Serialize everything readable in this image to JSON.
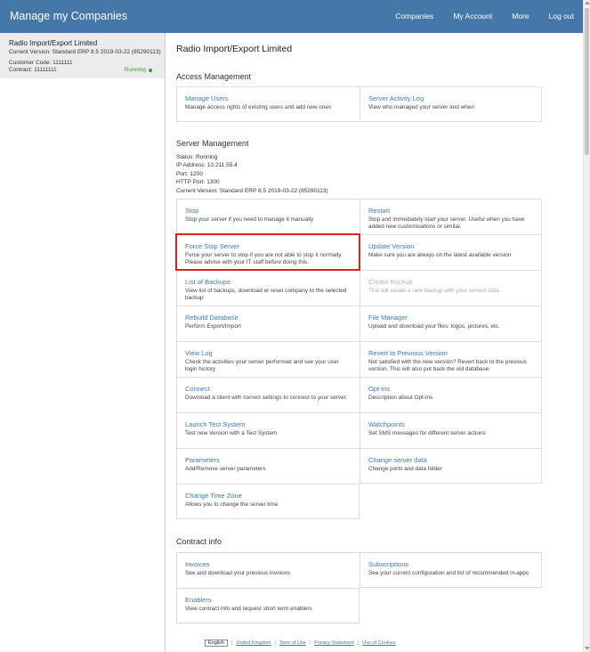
{
  "header": {
    "title": "Manage my Companies",
    "nav": [
      "Companies",
      "My Account",
      "More",
      "Log out"
    ]
  },
  "sidebar": {
    "company_name": "Radio Import/Export Limited",
    "version": "Current Version: Standard ERP 8.5 2019-03-22 (85290113)",
    "customer_code": "Customer Code: 1111111",
    "contract": "Contract: 11111111",
    "status": "Running"
  },
  "main": {
    "title": "Radio Import/Export Limited",
    "access_management": {
      "title": "Access Management",
      "items": [
        {
          "title": "Manage Users",
          "desc": "Manage access rights of existing users and add new ones"
        },
        {
          "title": "Server Activity Log",
          "desc": "View who managed your server and when"
        }
      ]
    },
    "server_management": {
      "title": "Server Management",
      "info": [
        "Status: Running",
        "IP Address: 10.211.55.4",
        "Port: 1200",
        "HTTP Port: 1300",
        "Current Version: Standard ERP 8.5 2019-03-22 (85290113)"
      ],
      "items": [
        {
          "title": "Stop",
          "desc": "Stop your server if you need to manage it manually"
        },
        {
          "title": "Restart",
          "desc": "Stop and immediately start your server. Useful when you have added new customisations or similar."
        },
        {
          "title": "Force Stop Server",
          "desc": "Force your server to stop if you are not able to stop it normally. Please advise with your IT staff before doing this."
        },
        {
          "title": "Update Version",
          "desc": "Make sure you are always on the latest available version"
        },
        {
          "title": "List of Backups",
          "desc": "View list of backups, download or reset company to the selected backup"
        },
        {
          "title": "Create Backup",
          "desc": "This will create a new backup with your current data."
        },
        {
          "title": "Rebuild Database",
          "desc": "Perform Export/Import"
        },
        {
          "title": "File Manager",
          "desc": "Upload and download your files: logos, pictures, etc."
        },
        {
          "title": "View Log",
          "desc": "Check the activities your server performed and see your user login history"
        },
        {
          "title": "Revert to Previous Version",
          "desc": "Not satisfied with the new version? Revert back to the previous version. This will also put back the old database."
        },
        {
          "title": "Connect",
          "desc": "Download a client with correct settings to connect to your server."
        },
        {
          "title": "Opt-ins",
          "desc": "Description about Opt-ins"
        },
        {
          "title": "Launch Test System",
          "desc": "Test new Version with a Test System"
        },
        {
          "title": "Watchpoints",
          "desc": "Set SMS messages for different server actions"
        },
        {
          "title": "Parameters",
          "desc": "Add/Remove server parameters"
        },
        {
          "title": "Change server data",
          "desc": "Change ports and data folder"
        },
        {
          "title": "Change Time Zone",
          "desc": "Allows you to change the server time"
        }
      ]
    },
    "contract_info": {
      "title": "Contract info",
      "items": [
        {
          "title": "Invoices",
          "desc": "See and download your previous invoices"
        },
        {
          "title": "Subscriptions",
          "desc": "See your current configuration and list of recommended in-apps"
        },
        {
          "title": "Enablers",
          "desc": "View contract info and request short term enablers"
        }
      ]
    }
  },
  "footer": {
    "language": "English",
    "links": [
      "United Kingdom",
      "Term of Use",
      "Privacy Statement",
      "Use of Cookies"
    ]
  },
  "colors": {
    "header_bg": "#4577a9",
    "link": "#3b7bbd",
    "status_running": "#3c9a3c",
    "highlight_border": "#d9231c"
  }
}
